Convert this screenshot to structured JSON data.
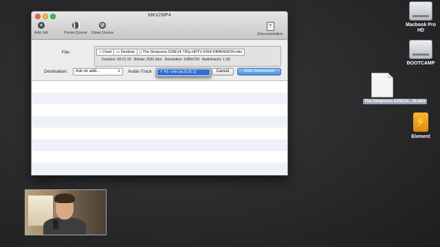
{
  "app": {
    "title": "MKV2MP4",
    "traffic_colors": [
      "#fc605c",
      "#fdbc40",
      "#34c84a"
    ]
  },
  "toolbar": {
    "add_job": "Add Job",
    "pause_queue": "Pause Queue",
    "clean_queue": "Clean Queue",
    "documentation": "Documentation"
  },
  "file": {
    "label": "File:",
    "path": [
      "Chad",
      "Desktop",
      "The.Simpsons.S25E14.720p.HDTV.X264-DIMENSION.mkv"
    ],
    "duration": "Duration: 00:21:15",
    "bitrate": "Bitrate: 2531 kb/s",
    "resolution": "Resolution: 1280x720",
    "audiotracks": "Audiotracks: 1 (0)"
  },
  "destination": {
    "label": "Destination:",
    "value": "Ask on add..."
  },
  "audio": {
    "label": "Audio-Track",
    "option": "✓ #1: unk (ac3) [5.1]"
  },
  "buttons": {
    "cancel": "Cancel",
    "start": "Start Conversion"
  },
  "desktop": {
    "macbook": "Macbook Pro HD",
    "bootcamp": "BOOTCAMP",
    "file": "The.Simpsons.S25E14....N.mkv",
    "element": "Element"
  },
  "accent": "#4d8fdc"
}
